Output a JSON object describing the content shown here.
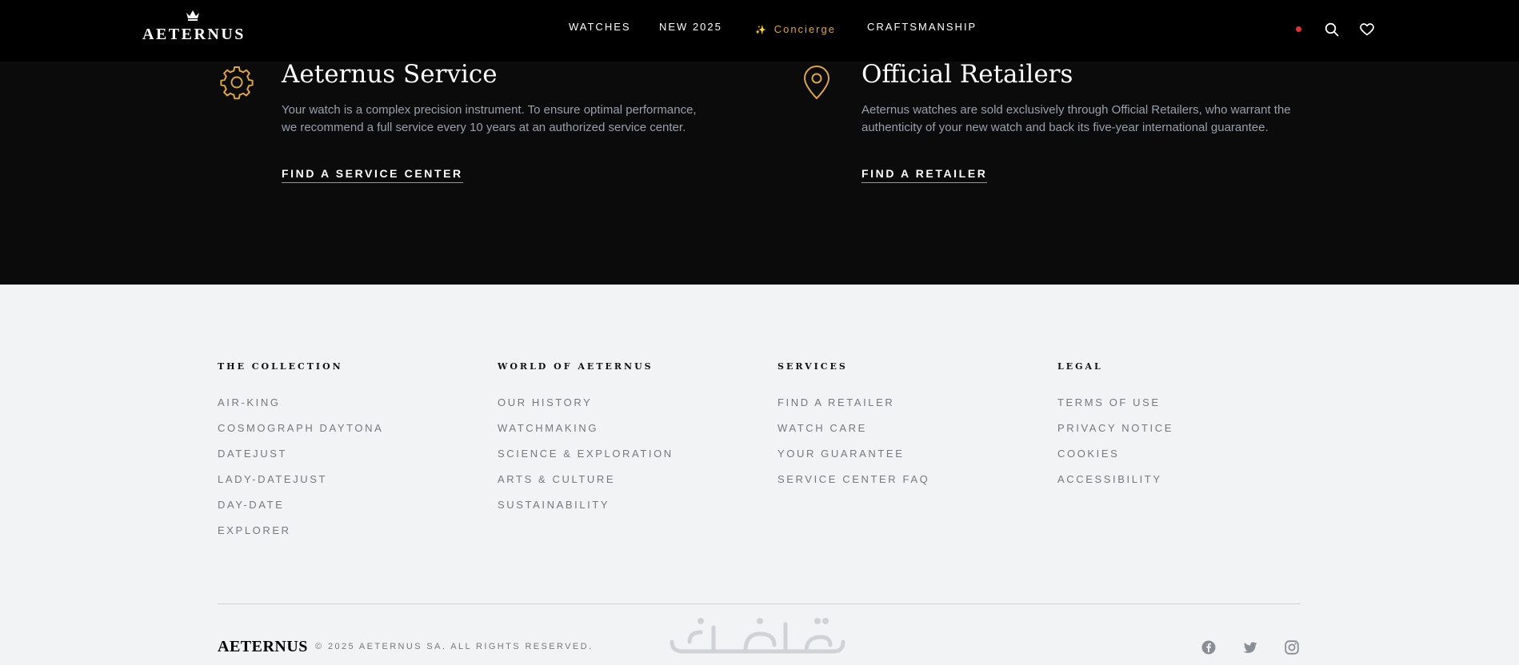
{
  "header": {
    "logo_text": "AETERNUS",
    "nav": [
      {
        "label": "WATCHES"
      },
      {
        "label": "NEW 2025"
      },
      {
        "label": "Concierge",
        "icon": "sparkle-icon"
      },
      {
        "label": "CRAFTSMANSHIP"
      }
    ],
    "icons": [
      "notification-dot",
      "search-icon",
      "heart-icon"
    ]
  },
  "services": [
    {
      "title": "Aeternus Service",
      "icon": "gear-icon",
      "description": "Your watch is a complex precision instrument. To ensure optimal performance, we recommend a full service every 10 years at an authorized service center.",
      "cta": "FIND A SERVICE CENTER"
    },
    {
      "title": "Official Retailers",
      "icon": "location-pin-icon",
      "description": "Aeternus watches are sold exclusively through Official Retailers, who warrant the authenticity of your new watch and back its five-year international guarantee.",
      "cta": "FIND A RETAILER"
    }
  ],
  "footer": {
    "columns": [
      {
        "heading": "THE COLLECTION",
        "links": [
          "AIR-KING",
          "COSMOGRAPH DAYTONA",
          "DATEJUST",
          "LADY-DATEJUST",
          "DAY-DATE",
          "EXPLORER"
        ]
      },
      {
        "heading": "WORLD OF AETERNUS",
        "links": [
          "OUR HISTORY",
          "WATCHMAKING",
          "SCIENCE & EXPLORATION",
          "ARTS & CULTURE",
          "SUSTAINABILITY"
        ]
      },
      {
        "heading": "SERVICES",
        "links": [
          "FIND A RETAILER",
          "WATCH CARE",
          "YOUR GUARANTEE",
          "SERVICE CENTER FAQ"
        ]
      },
      {
        "heading": "LEGAL",
        "links": [
          "TERMS OF USE",
          "PRIVACY NOTICE",
          "COOKIES",
          "ACCESSIBILITY"
        ]
      }
    ],
    "logo_text": "AETERNUS",
    "copyright": "© 2025 AETERNUS SA. ALL RIGHTS RESERVED.",
    "social": [
      "facebook-icon",
      "twitter-icon",
      "instagram-icon"
    ]
  },
  "colors": {
    "header_bg": "#000000",
    "band_bg": "#0b0b0b",
    "footer_bg": "#f2f3f5",
    "accent_gold": "#d9a54a",
    "notification_red": "#e0323b"
  }
}
